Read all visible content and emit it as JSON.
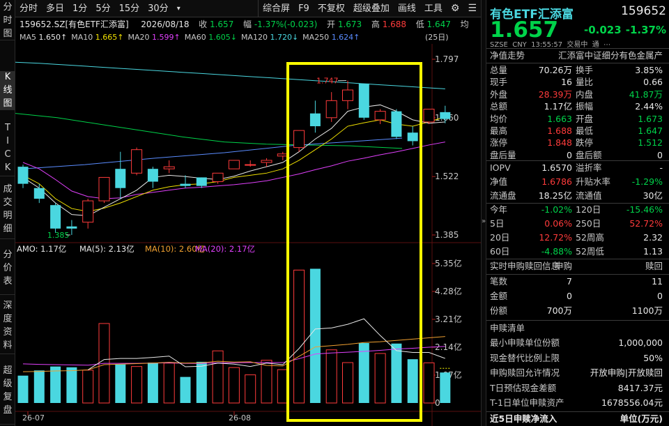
{
  "left_tabs": [
    {
      "label": "分时图",
      "active": false
    },
    {
      "label": "K线图",
      "active": true
    },
    {
      "label": "TICK",
      "active": false
    },
    {
      "label": "成交明细",
      "active": false
    },
    {
      "label": "分价表",
      "active": false
    },
    {
      "label": "深度资料",
      "active": false
    },
    {
      "label": "超级复盘",
      "active": false
    }
  ],
  "toolbar": {
    "left": [
      "分时",
      "多日",
      "1分",
      "5分",
      "15分",
      "30分"
    ],
    "more": "▾",
    "right": [
      "综合屏",
      "F9",
      "不复权",
      "超级叠加",
      "画线",
      "工具"
    ],
    "settings_icon": "gear-icon",
    "menu_icon": "menu-icon"
  },
  "info": {
    "code_name": "159652.SZ[有色ETF汇添富]",
    "date": "2026/08/18",
    "close_label": "收",
    "close": "1.657",
    "change_label": "幅",
    "change": "-1.37%(-0.023)",
    "open_label": "开",
    "open": "1.673",
    "high_label": "高",
    "high": "1.688",
    "low_label": "低",
    "low": "1.647",
    "extra": "均"
  },
  "ma_line": {
    "items": [
      {
        "label": "MA5",
        "value": "1.650↑",
        "color": "#e8e8e8"
      },
      {
        "label": "MA10",
        "value": "1.665↑",
        "color": "#f0e000"
      },
      {
        "label": "MA20",
        "value": "1.599↑",
        "color": "#e040fb"
      },
      {
        "label": "MA60",
        "value": "1.605↓",
        "color": "#00d34a"
      },
      {
        "label": "MA120",
        "value": "1.720↓",
        "color": "#4ad7e0"
      },
      {
        "label": "MA250",
        "value": "1.624↑",
        "color": "#5a8cff"
      }
    ],
    "period": "(25日)"
  },
  "kchart": {
    "price_ticks": [
      "1.797",
      "1.660",
      "1.522",
      "1.385"
    ],
    "high_label": "1.747",
    "low_label": "1.385"
  },
  "vol": {
    "label": "AMO: 1.17亿",
    "ma5": "MA(5): 2.13亿",
    "ma10": "MA(10): 2.60亿",
    "ma20": "MA(20): 2.17亿",
    "ticks": [
      "5.35亿",
      "4.28亿",
      "3.21亿",
      "2.14亿",
      "1.07亿",
      "0"
    ]
  },
  "xaxis": [
    "26-07",
    "26-08"
  ],
  "colors": {
    "up": "#ff3b3b",
    "down": "#4ad7e0",
    "highlight": "#ffff00",
    "ma5": "#e8e8e8",
    "ma10": "#f0e000",
    "ma20": "#e040fb",
    "ma60": "#00d34a",
    "ma120": "#4ad7e0",
    "ma250": "#5a8cff"
  },
  "chart_data": {
    "type": "candlestick",
    "candles": [
      {
        "o": 1.545,
        "h": 1.55,
        "l": 1.495,
        "c": 1.505
      },
      {
        "o": 1.495,
        "h": 1.505,
        "l": 1.46,
        "c": 1.47
      },
      {
        "o": 1.455,
        "h": 1.46,
        "l": 1.39,
        "c": 1.4
      },
      {
        "o": 1.405,
        "h": 1.42,
        "l": 1.385,
        "c": 1.4
      },
      {
        "o": 1.415,
        "h": 1.47,
        "l": 1.4,
        "c": 1.465
      },
      {
        "o": 1.465,
        "h": 1.52,
        "l": 1.46,
        "c": 1.52
      },
      {
        "o": 1.54,
        "h": 1.58,
        "l": 1.47,
        "c": 1.495
      },
      {
        "o": 1.53,
        "h": 1.59,
        "l": 1.525,
        "c": 1.585
      },
      {
        "o": 1.54,
        "h": 1.545,
        "l": 1.495,
        "c": 1.51
      },
      {
        "o": 1.54,
        "h": 1.56,
        "l": 1.53,
        "c": 1.545
      },
      {
        "o": 1.505,
        "h": 1.525,
        "l": 1.495,
        "c": 1.5
      },
      {
        "o": 1.52,
        "h": 1.52,
        "l": 1.495,
        "c": 1.5
      },
      {
        "o": 1.51,
        "h": 1.53,
        "l": 1.505,
        "c": 1.53
      },
      {
        "o": 1.54,
        "h": 1.56,
        "l": 1.54,
        "c": 1.56
      },
      {
        "o": 1.55,
        "h": 1.56,
        "l": 1.545,
        "c": 1.55
      },
      {
        "o": 1.555,
        "h": 1.565,
        "l": 1.545,
        "c": 1.56
      },
      {
        "o": 1.57,
        "h": 1.58,
        "l": 1.56,
        "c": 1.575
      },
      {
        "o": 1.59,
        "h": 1.63,
        "l": 1.58,
        "c": 1.63
      },
      {
        "o": 1.67,
        "h": 1.7,
        "l": 1.625,
        "c": 1.64
      },
      {
        "o": 1.66,
        "h": 1.72,
        "l": 1.65,
        "c": 1.7
      },
      {
        "o": 1.7,
        "h": 1.747,
        "l": 1.68,
        "c": 1.725
      },
      {
        "o": 1.74,
        "h": 1.74,
        "l": 1.655,
        "c": 1.66
      },
      {
        "o": 1.655,
        "h": 1.68,
        "l": 1.645,
        "c": 1.675
      },
      {
        "o": 1.675,
        "h": 1.68,
        "l": 1.61,
        "c": 1.615
      },
      {
        "o": 1.625,
        "h": 1.64,
        "l": 1.595,
        "c": 1.605
      },
      {
        "o": 1.65,
        "h": 1.68,
        "l": 1.645,
        "c": 1.68
      },
      {
        "o": 1.673,
        "h": 1.688,
        "l": 1.647,
        "c": 1.657
      }
    ],
    "volumes": [
      1.05,
      1.25,
      1.4,
      1.37,
      1.26,
      3.05,
      1.48,
      1.4,
      1.55,
      1.53,
      1.0,
      1.58,
      2.0,
      1.36,
      1.08,
      1.64,
      1.28,
      5.1,
      5.15,
      2.04,
      1.55,
      2.3,
      1.9,
      2.28,
      1.68,
      1.54,
      1.17
    ],
    "vol_ma5": [
      null,
      null,
      null,
      null,
      1.27,
      1.67,
      1.71,
      1.71,
      1.75,
      1.8,
      1.39,
      1.41,
      1.53,
      1.49,
      1.4,
      1.53,
      1.47,
      2.09,
      2.84,
      2.88,
      3.02,
      3.23,
      2.59,
      2.01,
      1.94,
      1.94,
      1.71
    ],
    "vol_ma10": [
      1.2,
      1.21,
      1.23,
      1.24,
      1.27,
      1.47,
      1.49,
      1.51,
      1.53,
      1.56,
      1.53,
      1.54,
      1.6,
      1.57,
      1.58,
      1.44,
      1.42,
      1.79,
      2.15,
      2.2,
      2.25,
      2.32,
      2.35,
      2.4,
      2.45,
      2.5,
      2.55
    ],
    "vol_ma20": [
      1.5,
      1.48,
      1.47,
      1.46,
      1.45,
      1.52,
      1.52,
      1.52,
      1.53,
      1.54,
      1.52,
      1.52,
      1.54,
      1.54,
      1.55,
      1.55,
      1.55,
      1.7,
      1.88,
      1.92,
      1.95,
      1.98,
      2.02,
      2.07,
      2.1,
      2.14,
      2.17
    ],
    "ylim": [
      1.385,
      1.797
    ],
    "vol_ylim": [
      0,
      5.35
    ]
  },
  "quote": {
    "name": "有色ETF汇添富",
    "code": "159652",
    "price": "1.657",
    "change": "-0.023",
    "pct": "-1.37%",
    "sub": "SZSE  CNY  13:55:57  交易中  通  ⋯"
  },
  "rp": {
    "title_left": "净值走势",
    "title_right": "汇添富中证细分有色金属产",
    "rows1": [
      {
        "l": "总量",
        "v": "70.26万",
        "vc": "white",
        "l2": "换手",
        "v2": "3.85%",
        "v2c": "white"
      },
      {
        "l": "现手",
        "v": "16",
        "vc": "white",
        "l2": "量比",
        "v2": "0.66",
        "v2c": "white"
      },
      {
        "l": "外盘",
        "v": "28.39万",
        "vc": "red",
        "l2": "内盘",
        "v2": "41.87万",
        "v2c": "green"
      },
      {
        "l": "总额",
        "v": "1.17亿",
        "vc": "white",
        "l2": "振幅",
        "v2": "2.44%",
        "v2c": "white"
      },
      {
        "l": "均价",
        "v": "1.663",
        "vc": "green",
        "l2": "开盘",
        "v2": "1.673",
        "v2c": "green"
      },
      {
        "l": "最高",
        "v": "1.688",
        "vc": "red",
        "l2": "最低",
        "v2": "1.647",
        "v2c": "green"
      },
      {
        "l": "涨停",
        "v": "1.848",
        "vc": "red",
        "l2": "跌停",
        "v2": "1.512",
        "v2c": "green"
      },
      {
        "l": "盘后量",
        "v": "0",
        "vc": "white",
        "l2": "盘后额",
        "v2": "0",
        "v2c": "white"
      }
    ],
    "rows2": [
      {
        "l": "IOPV",
        "v": "1.6570",
        "vc": "white",
        "l2": "溢折率",
        "v2": "-",
        "v2c": "white"
      },
      {
        "l": "净值",
        "v": "1.6786",
        "vc": "red",
        "l2": "升贴水率",
        "v2": "-1.29%",
        "v2c": "green"
      },
      {
        "l": "流通盘",
        "v": "18.25亿",
        "vc": "white",
        "l2": "流通值",
        "v2": "30亿",
        "v2c": "white"
      }
    ],
    "rows3": [
      {
        "l": "今年",
        "v": "-1.02%",
        "vc": "green",
        "l2": "120日",
        "v2": "-15.46%",
        "v2c": "green"
      },
      {
        "l": "5日",
        "v": "0.06%",
        "vc": "red",
        "l2": "250日",
        "v2": "52.72%",
        "v2c": "red"
      },
      {
        "l": "20日",
        "v": "12.72%",
        "vc": "red",
        "l2": "52周高",
        "v2": "2.32",
        "v2c": "white"
      },
      {
        "l": "60日",
        "v": "-4.88%",
        "vc": "green",
        "l2": "52周低",
        "v2": "1.13",
        "v2c": "white"
      }
    ],
    "sg_title": "实时申购赎回信息",
    "sg_h1": "申购",
    "sg_h2": "赎回",
    "sg_rows": [
      {
        "l": "笔数",
        "v": "7",
        "v2": "11"
      },
      {
        "l": "金额",
        "v": "0",
        "v2": "0"
      },
      {
        "l": "份额",
        "v": "700万",
        "v2": "1100万"
      }
    ],
    "list_title": "申赎清单",
    "list_rows": [
      {
        "l": "最小申赎单位份额",
        "v": "1,000,000"
      },
      {
        "l": "现金替代比例上限",
        "v": "50%"
      },
      {
        "l": "申购赎回允许情况",
        "v": "开放申购|开放赎回"
      },
      {
        "l": "T日预估现金差额",
        "v": "8417.37元"
      },
      {
        "l": "T-1日单位申赎资产",
        "v": "1678556.04元"
      }
    ],
    "bottom_left": "近5日申赎净流入",
    "bottom_right": "单位(万元)"
  }
}
